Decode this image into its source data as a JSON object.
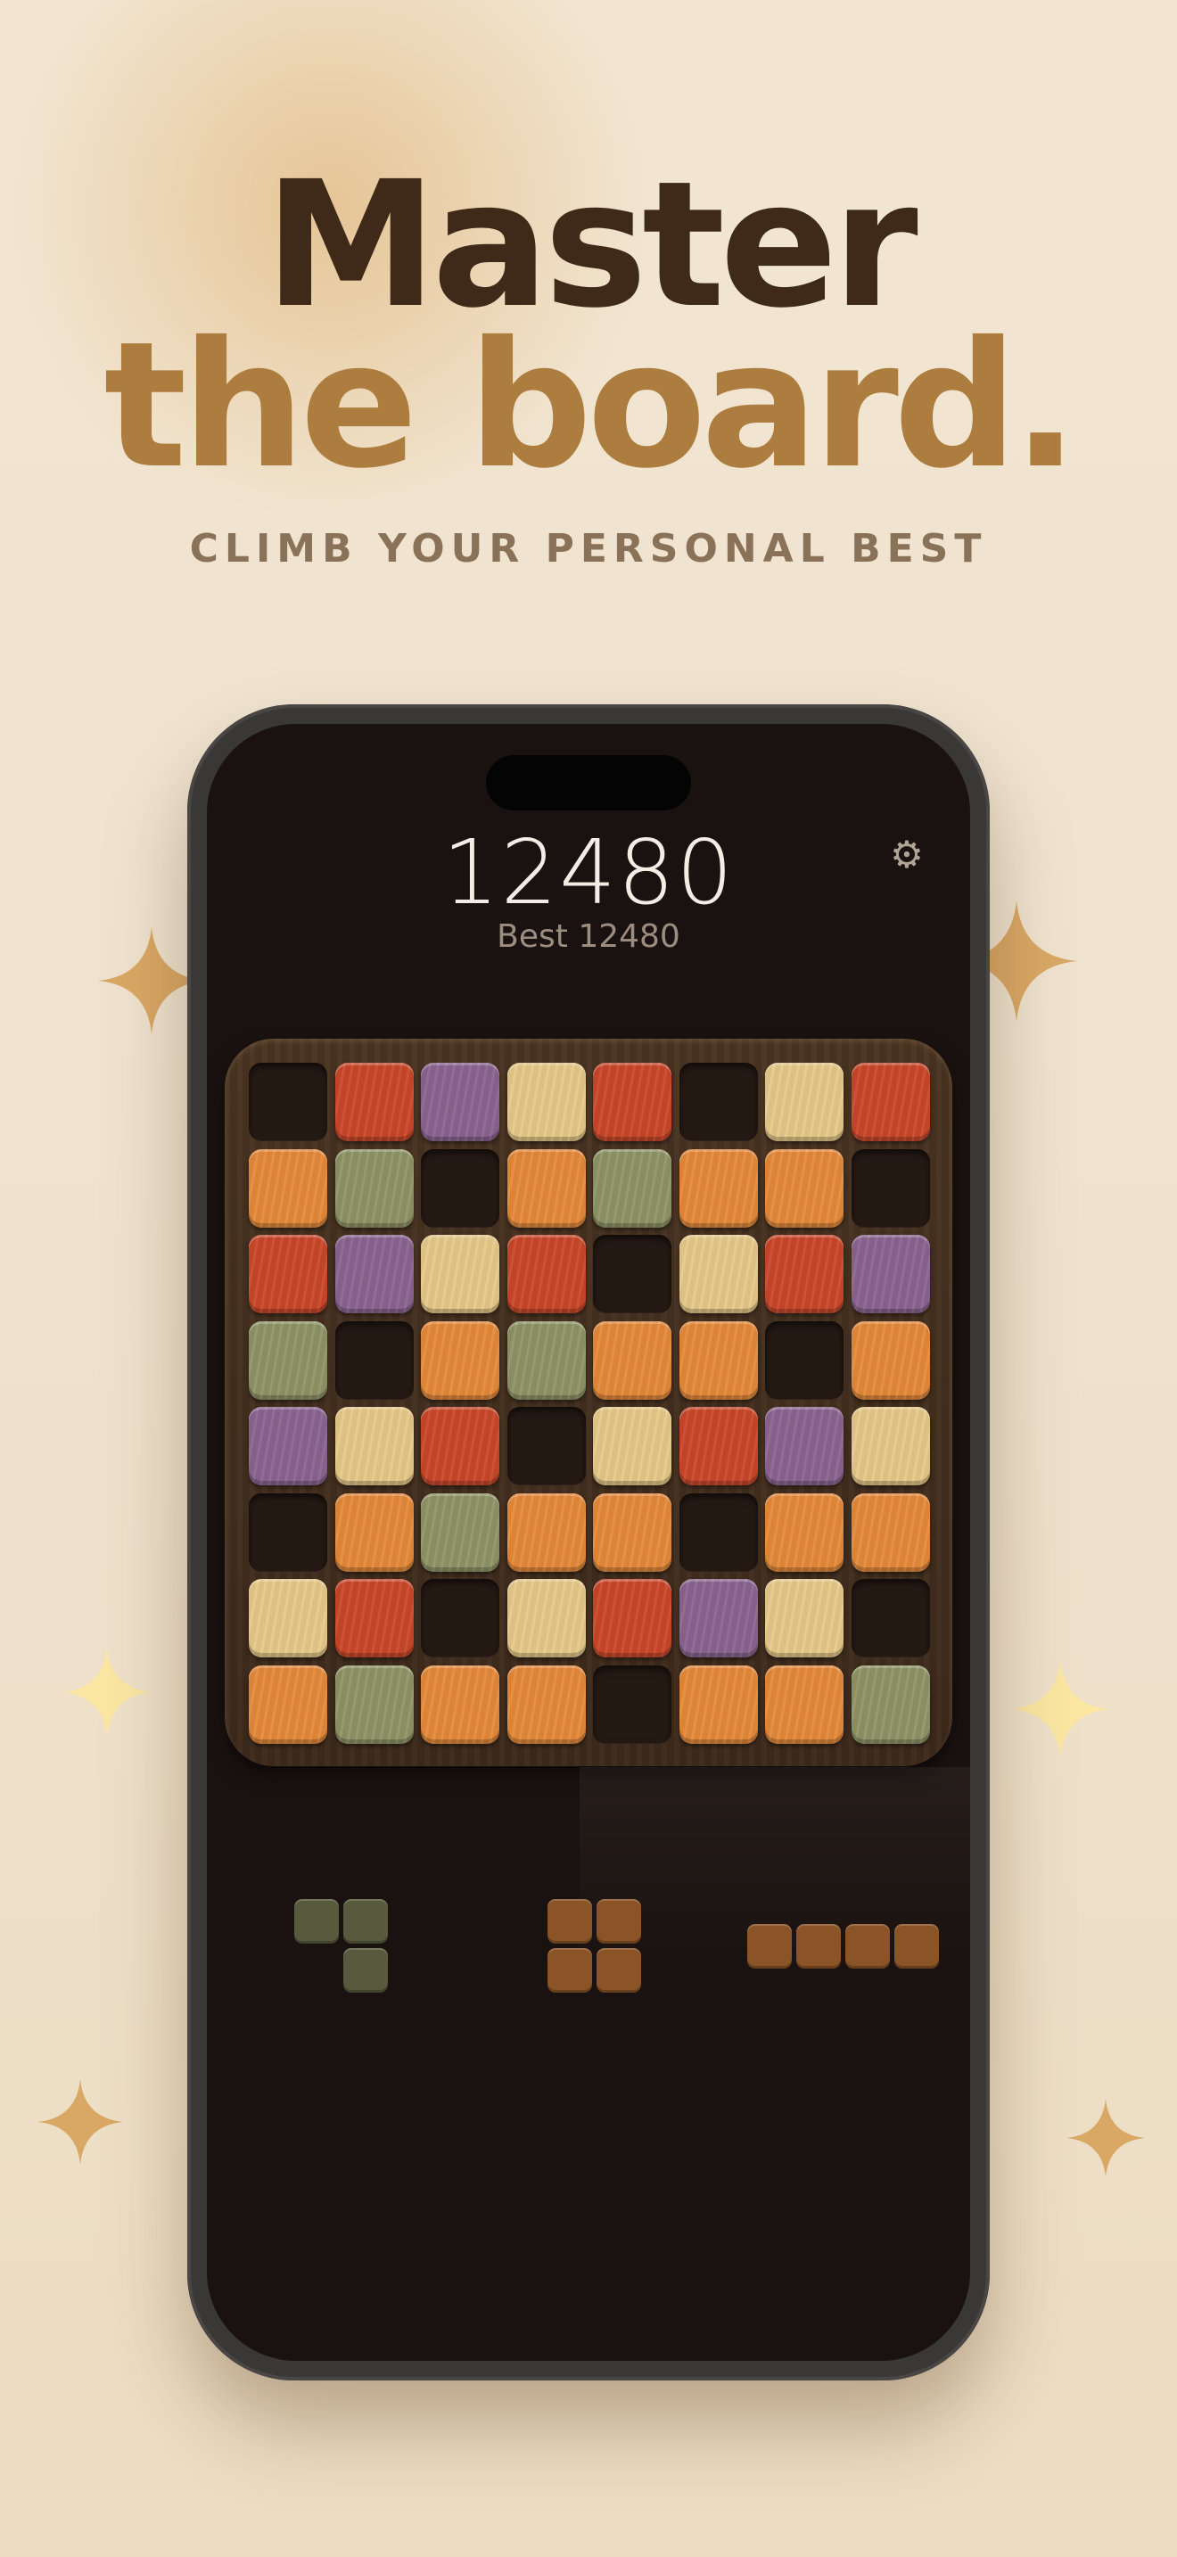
{
  "headline": {
    "line1": "Master",
    "line2": "the board."
  },
  "tagline": "CLIMB YOUR PERSONAL BEST",
  "game": {
    "score": "12480",
    "best": "Best 12480",
    "settings_icon": "⚙"
  },
  "colors": {
    "R": "#c9472a",
    "P": "#8a6490",
    "Y": "#e6c888",
    "O": "#e4893a",
    "G": "#8e9466",
    "E": "#251914"
  },
  "board": [
    [
      "E",
      "R",
      "P",
      "Y",
      "R",
      "E",
      "Y",
      "R"
    ],
    [
      "O",
      "G",
      "E",
      "O",
      "G",
      "O",
      "O",
      "E"
    ],
    [
      "R",
      "P",
      "Y",
      "R",
      "E",
      "Y",
      "R",
      "P"
    ],
    [
      "G",
      "E",
      "O",
      "G",
      "O",
      "O",
      "E",
      "O"
    ],
    [
      "P",
      "Y",
      "R",
      "E",
      "Y",
      "R",
      "P",
      "Y"
    ],
    [
      "E",
      "O",
      "G",
      "O",
      "O",
      "E",
      "O",
      "O"
    ],
    [
      "Y",
      "R",
      "E",
      "Y",
      "R",
      "P",
      "Y",
      "E"
    ],
    [
      "O",
      "G",
      "O",
      "O",
      "E",
      "O",
      "O",
      "G"
    ]
  ],
  "pieces": [
    {
      "color": "#575a3c",
      "cells": [
        [
          0,
          0
        ],
        [
          1,
          0
        ],
        [
          1,
          1
        ]
      ]
    },
    {
      "color": "#8a5427",
      "cells": [
        [
          0,
          0
        ],
        [
          1,
          0
        ],
        [
          0,
          1
        ],
        [
          1,
          1
        ]
      ]
    },
    {
      "color": "#8a5427",
      "cells": [
        [
          0,
          0
        ],
        [
          1,
          0
        ],
        [
          2,
          0
        ],
        [
          3,
          0
        ]
      ]
    }
  ]
}
